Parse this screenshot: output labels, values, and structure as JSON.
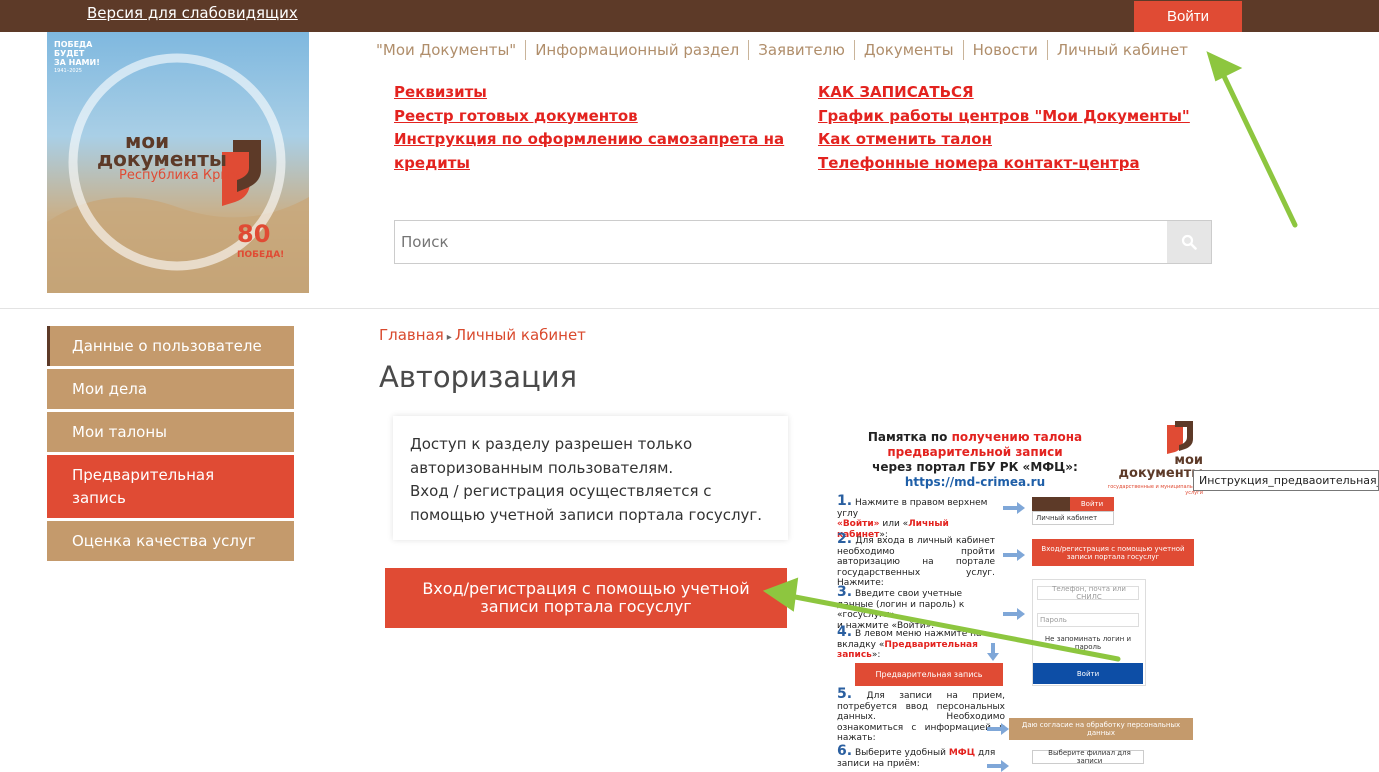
{
  "topbar": {
    "vision_link": "Версия для слабовидящих",
    "login_button": "Войти"
  },
  "logo": {
    "line1": "ПОБЕДА",
    "line2": "БУДЕТ",
    "line3": "ЗА НАМИ!",
    "years": "1941–2025",
    "brand1": "мои",
    "brand2": "документы",
    "region": "Республика Крым",
    "anniv": "80",
    "pobeda": "ПОБЕДА!"
  },
  "nav": [
    "\"Мои Документы\"",
    "Информационный раздел",
    "Заявителю",
    "Документы",
    "Новости",
    "Личный кабинет"
  ],
  "quick_links_left": [
    "Реквизиты",
    "Реестр готовых документов",
    "Инструкция по оформлению самозапрета на",
    "кредиты"
  ],
  "quick_links_right": [
    "КАК ЗАПИСАТЬСЯ",
    "График работы центров \"Мои Документы\"",
    "Как отменить талон",
    "Телефонные номера контакт-центра"
  ],
  "search": {
    "placeholder": "Поиск"
  },
  "sidebar": [
    {
      "label": "Данные о пользователе"
    },
    {
      "label": "Мои дела"
    },
    {
      "label": "Мои талоны"
    },
    {
      "label_line1": "Предварительная",
      "label_line2": "запись"
    },
    {
      "label": "Оценка качества услуг"
    }
  ],
  "breadcrumb": {
    "home": "Главная",
    "current": "Личный кабинет"
  },
  "page_title": "Авторизация",
  "notice": {
    "line1": "Доступ к разделу разрешен только",
    "line2": "авторизованным пользователям.",
    "line3": "Вход / регистрация осуществляется с",
    "line4": "помощью учетной записи портала госуслуг."
  },
  "gosuslugi_button": {
    "line1": "Вход/регистрация с помощью учетной",
    "line2": "записи портала госуслуг"
  },
  "memo": {
    "title_a": "Памятка по ",
    "title_b": "получению талона",
    "title_c": "предварительной записи",
    "title_d": "через портал ГБУ РК «МФЦ»:",
    "url": "https://md-crimea.ru",
    "brand": "мои документы",
    "brand_sub": "государственные и муниципальные услуги",
    "s1_num": "1.",
    "s1_text": "Нажмите в правом верхнем углу",
    "s1_a": "«Войти»",
    "s1_or": " или «",
    "s1_b": "Личный кабинет",
    "s1_end": "»:",
    "s1_mini_btn": "Войти",
    "s1_mini_cab": "Личный кабинет",
    "s2_num": "2.",
    "s2_text": "Для входа в личный кабинет необходимо пройти авторизацию на портале государственных услуг. Нажмите:",
    "s2_mini": "Вход/регистрация с помощью учетной записи портала госуслуг",
    "s3_num": "3.",
    "s3_text": "Введите свои учетные данные (логин и пароль) к «госуслуги»",
    "s3_tail": "и нажмите «Войти»:",
    "s3_phone": "Телефон, почта или СНИЛС",
    "s3_pass": "Пароль",
    "s3_remember": "Не запоминать логин и пароль",
    "s3_login": "Войти",
    "s4_num": "4.",
    "s4_text": "В левом меню нажмите на вкладку «",
    "s4_red": "Предварительная запись",
    "s4_end": "»:",
    "s4_mini": "Предварительная запись",
    "s5_num": "5.",
    "s5_text": "Для записи на прием, потребуется ввод персональных данных. Необходимо ознакомиться с информацией и нажать:",
    "s5_mini": "Даю согласие на обработку персональных данных",
    "s6_num": "6.",
    "s6_text": "Выберите удобный",
    "s6_red": "МФЦ",
    "s6_end": "для записи на приём:",
    "s6_select": "Выберите филиал для записи"
  },
  "tooltip": "Инструкция_предваоительная_запись",
  "colors": {
    "topbar": "#5d3a28",
    "accent_red": "#e04b34",
    "sidebar_tan": "#c49a6c",
    "link_red": "#e3231f",
    "nav_tan": "#b08e6b",
    "arrow_green": "#8dc63f"
  }
}
